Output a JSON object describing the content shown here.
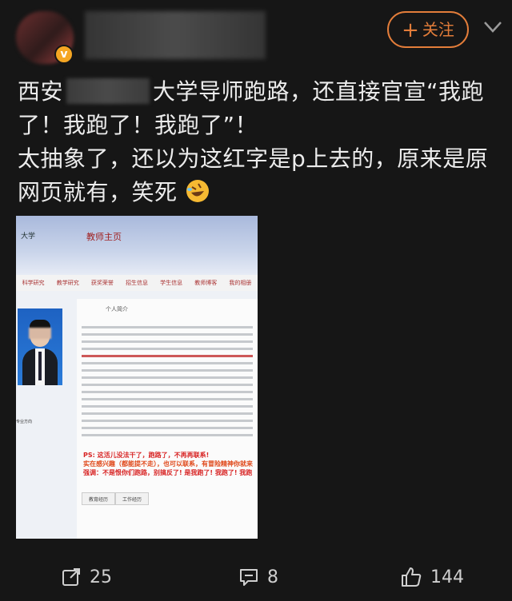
{
  "header": {
    "follow_label": "关注",
    "verified_badge": "v"
  },
  "post": {
    "text_part1": "西安",
    "text_part2": "大学导师跑路，还直接官宣“我跑了！我跑了！我跑了”！",
    "text_line3": "太抽象了，还以为这红字是p上去的，原来是原网页就有，笑死",
    "emoji": "rolling-on-floor-laughing-icon"
  },
  "image": {
    "banner_title": "教师主页",
    "banner_logo": "大学",
    "nav_items": [
      "科学研究",
      "教学研究",
      "获奖荣誉",
      "招生信息",
      "学生信息",
      "教师博客",
      "我的相册"
    ],
    "panel_title": "个人简介",
    "ps_line1": "PS: 这活儿没法干了，跑路了，不再再联系!",
    "ps_line2": "实在感兴趣（都能提不走），也可以联系，有冒险精神你就来",
    "ps_line3": "强调：不是恨你们跑路，别搞反了! 是我跑了! 我跑了! 我跑",
    "tab1": "教育经历",
    "tab2": "工作经历",
    "left_info": "专业方向"
  },
  "footer": {
    "repost_count": "25",
    "comment_count": "8",
    "like_count": "144"
  },
  "colors": {
    "background": "#161616",
    "accent": "#e37d3a",
    "text": "#ececec",
    "ps_red": "#d82424"
  }
}
